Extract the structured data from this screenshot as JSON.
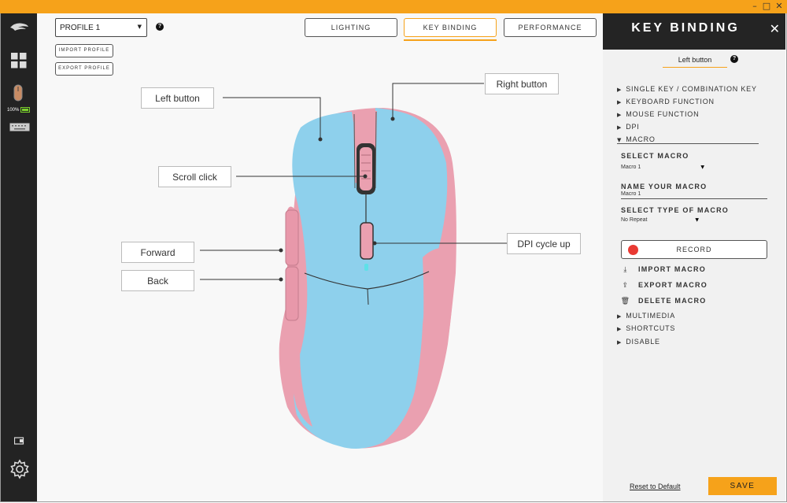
{
  "window": {
    "minimize": "–",
    "maximize": "□",
    "close": "✕"
  },
  "sidebar": {
    "battery": "100%",
    "icons": [
      "logo-icon",
      "grid-icon",
      "mouse-icon",
      "keyboard-icon",
      "device-icon",
      "gear-icon"
    ]
  },
  "profile": {
    "selected": "PROFILE 1",
    "help": "?",
    "import_label": "IMPORT PROFILE",
    "export_label": "EXPORT PROFILE"
  },
  "tabs": [
    {
      "label": "LIGHTING",
      "active": false
    },
    {
      "label": "KEY BINDING",
      "active": true
    },
    {
      "label": "PERFORMANCE",
      "active": false
    }
  ],
  "callouts": {
    "left_button": "Left button",
    "right_button": "Right button",
    "scroll_click": "Scroll click",
    "forward": "Forward",
    "back": "Back",
    "dpi_cycle": "DPI cycle up"
  },
  "colors": {
    "accent": "#f6a21a",
    "mouse_blue": "#8ed0ec",
    "mouse_pink": "#eaa0b0",
    "record_dot": "#e93a33"
  },
  "panel": {
    "title": "KEY BINDING",
    "close": "✕",
    "selected_button": "Left button",
    "help": "?",
    "menu": {
      "single_key": "SINGLE KEY / COMBINATION KEY",
      "keyboard_function": "KEYBOARD FUNCTION",
      "mouse_function": "MOUSE FUNCTION",
      "dpi": "DPI",
      "macro": "MACRO",
      "multimedia": "MULTIMEDIA",
      "shortcuts": "SHORTCUTS",
      "disable": "DISABLE"
    },
    "macro": {
      "select_label": "SELECT MACRO",
      "select_value": "Macro 1",
      "name_label": "NAME YOUR MACRO",
      "name_value": "Macro 1",
      "type_label": "SELECT TYPE OF MACRO",
      "type_value": "No Repeat",
      "record_label": "RECORD",
      "import_label": "IMPORT MACRO",
      "export_label": "EXPORT MACRO",
      "delete_label": "DELETE MACRO"
    },
    "reset_label": "Reset to Default",
    "save_label": "SAVE"
  }
}
